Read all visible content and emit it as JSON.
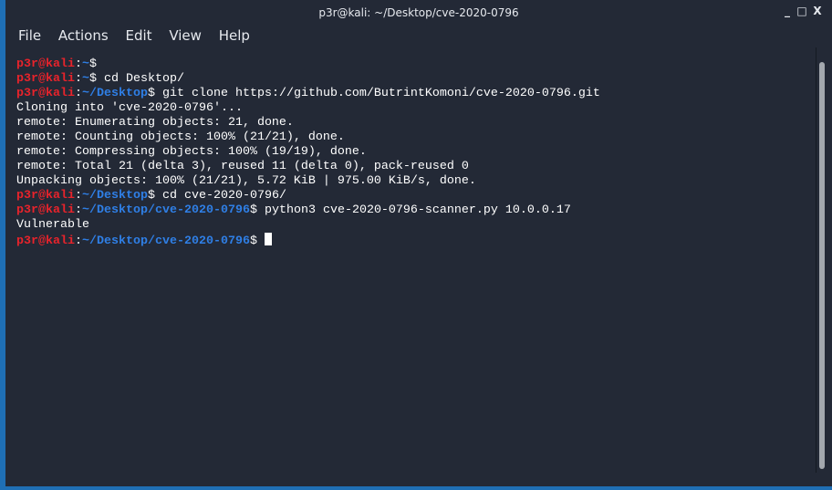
{
  "window": {
    "title": "p3r@kali: ~/Desktop/cve-2020-0796",
    "controls": {
      "minimize": "_",
      "maximize": "□",
      "close": "X"
    }
  },
  "menu": [
    "File",
    "Actions",
    "Edit",
    "View",
    "Help"
  ],
  "colors": {
    "user": "#e8232b",
    "path": "#2f7fe6",
    "background": "#232936",
    "text": "#ffffff"
  },
  "terminal": {
    "lines": [
      [
        {
          "t": "u",
          "s": "p3r@kali"
        },
        {
          "t": "c",
          "s": ":"
        },
        {
          "t": "p",
          "s": "~"
        },
        {
          "t": "c",
          "s": "$"
        }
      ],
      [
        {
          "t": "u",
          "s": "p3r@kali"
        },
        {
          "t": "c",
          "s": ":"
        },
        {
          "t": "p",
          "s": "~"
        },
        {
          "t": "c",
          "s": "$ cd Desktop/"
        }
      ],
      [
        {
          "t": "u",
          "s": "p3r@kali"
        },
        {
          "t": "c",
          "s": ":"
        },
        {
          "t": "p",
          "s": "~/Desktop"
        },
        {
          "t": "c",
          "s": "$ git clone https://github.com/ButrintKomoni/cve-2020-0796.git"
        }
      ],
      [
        {
          "t": "c",
          "s": "Cloning into 'cve-2020-0796'..."
        }
      ],
      [
        {
          "t": "c",
          "s": "remote: Enumerating objects: 21, done."
        }
      ],
      [
        {
          "t": "c",
          "s": "remote: Counting objects: 100% (21/21), done."
        }
      ],
      [
        {
          "t": "c",
          "s": "remote: Compressing objects: 100% (19/19), done."
        }
      ],
      [
        {
          "t": "c",
          "s": "remote: Total 21 (delta 3), reused 11 (delta 0), pack-reused 0"
        }
      ],
      [
        {
          "t": "c",
          "s": "Unpacking objects: 100% (21/21), 5.72 KiB | 975.00 KiB/s, done."
        }
      ],
      [
        {
          "t": "u",
          "s": "p3r@kali"
        },
        {
          "t": "c",
          "s": ":"
        },
        {
          "t": "p",
          "s": "~/Desktop"
        },
        {
          "t": "c",
          "s": "$ cd cve-2020-0796/"
        }
      ],
      [
        {
          "t": "u",
          "s": "p3r@kali"
        },
        {
          "t": "c",
          "s": ":"
        },
        {
          "t": "p",
          "s": "~/Desktop/cve-2020-0796"
        },
        {
          "t": "c",
          "s": "$ python3 cve-2020-0796-scanner.py 10.0.0.17"
        }
      ],
      [
        {
          "t": "c",
          "s": "Vulnerable"
        }
      ],
      [
        {
          "t": "u",
          "s": "p3r@kali"
        },
        {
          "t": "c",
          "s": ":"
        },
        {
          "t": "p",
          "s": "~/Desktop/cve-2020-0796"
        },
        {
          "t": "c",
          "s": "$ "
        }
      ]
    ]
  }
}
